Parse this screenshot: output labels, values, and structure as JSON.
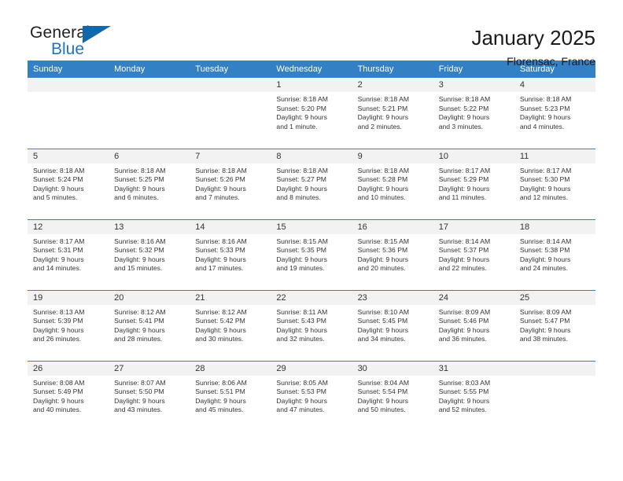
{
  "brand": {
    "name_top": "General",
    "name_bottom": "Blue",
    "accent_color": "#1268ad",
    "text_color": "#231f20"
  },
  "header": {
    "title": "January 2025",
    "location": "Florensac, France"
  },
  "calendar": {
    "header_bg": "#3480c4",
    "daynum_bg": "#f2f2f2",
    "weekdays": [
      "Sunday",
      "Monday",
      "Tuesday",
      "Wednesday",
      "Thursday",
      "Friday",
      "Saturday"
    ],
    "weeks": [
      [
        {
          "day": "",
          "sunrise": "",
          "sunset": "",
          "daylight_1": "",
          "daylight_2": ""
        },
        {
          "day": "",
          "sunrise": "",
          "sunset": "",
          "daylight_1": "",
          "daylight_2": ""
        },
        {
          "day": "",
          "sunrise": "",
          "sunset": "",
          "daylight_1": "",
          "daylight_2": ""
        },
        {
          "day": "1",
          "sunrise": "Sunrise: 8:18 AM",
          "sunset": "Sunset: 5:20 PM",
          "daylight_1": "Daylight: 9 hours",
          "daylight_2": "and 1 minute."
        },
        {
          "day": "2",
          "sunrise": "Sunrise: 8:18 AM",
          "sunset": "Sunset: 5:21 PM",
          "daylight_1": "Daylight: 9 hours",
          "daylight_2": "and 2 minutes."
        },
        {
          "day": "3",
          "sunrise": "Sunrise: 8:18 AM",
          "sunset": "Sunset: 5:22 PM",
          "daylight_1": "Daylight: 9 hours",
          "daylight_2": "and 3 minutes."
        },
        {
          "day": "4",
          "sunrise": "Sunrise: 8:18 AM",
          "sunset": "Sunset: 5:23 PM",
          "daylight_1": "Daylight: 9 hours",
          "daylight_2": "and 4 minutes."
        }
      ],
      [
        {
          "day": "5",
          "sunrise": "Sunrise: 8:18 AM",
          "sunset": "Sunset: 5:24 PM",
          "daylight_1": "Daylight: 9 hours",
          "daylight_2": "and 5 minutes."
        },
        {
          "day": "6",
          "sunrise": "Sunrise: 8:18 AM",
          "sunset": "Sunset: 5:25 PM",
          "daylight_1": "Daylight: 9 hours",
          "daylight_2": "and 6 minutes."
        },
        {
          "day": "7",
          "sunrise": "Sunrise: 8:18 AM",
          "sunset": "Sunset: 5:26 PM",
          "daylight_1": "Daylight: 9 hours",
          "daylight_2": "and 7 minutes."
        },
        {
          "day": "8",
          "sunrise": "Sunrise: 8:18 AM",
          "sunset": "Sunset: 5:27 PM",
          "daylight_1": "Daylight: 9 hours",
          "daylight_2": "and 8 minutes."
        },
        {
          "day": "9",
          "sunrise": "Sunrise: 8:18 AM",
          "sunset": "Sunset: 5:28 PM",
          "daylight_1": "Daylight: 9 hours",
          "daylight_2": "and 10 minutes."
        },
        {
          "day": "10",
          "sunrise": "Sunrise: 8:17 AM",
          "sunset": "Sunset: 5:29 PM",
          "daylight_1": "Daylight: 9 hours",
          "daylight_2": "and 11 minutes."
        },
        {
          "day": "11",
          "sunrise": "Sunrise: 8:17 AM",
          "sunset": "Sunset: 5:30 PM",
          "daylight_1": "Daylight: 9 hours",
          "daylight_2": "and 12 minutes."
        }
      ],
      [
        {
          "day": "12",
          "sunrise": "Sunrise: 8:17 AM",
          "sunset": "Sunset: 5:31 PM",
          "daylight_1": "Daylight: 9 hours",
          "daylight_2": "and 14 minutes."
        },
        {
          "day": "13",
          "sunrise": "Sunrise: 8:16 AM",
          "sunset": "Sunset: 5:32 PM",
          "daylight_1": "Daylight: 9 hours",
          "daylight_2": "and 15 minutes."
        },
        {
          "day": "14",
          "sunrise": "Sunrise: 8:16 AM",
          "sunset": "Sunset: 5:33 PM",
          "daylight_1": "Daylight: 9 hours",
          "daylight_2": "and 17 minutes."
        },
        {
          "day": "15",
          "sunrise": "Sunrise: 8:15 AM",
          "sunset": "Sunset: 5:35 PM",
          "daylight_1": "Daylight: 9 hours",
          "daylight_2": "and 19 minutes."
        },
        {
          "day": "16",
          "sunrise": "Sunrise: 8:15 AM",
          "sunset": "Sunset: 5:36 PM",
          "daylight_1": "Daylight: 9 hours",
          "daylight_2": "and 20 minutes."
        },
        {
          "day": "17",
          "sunrise": "Sunrise: 8:14 AM",
          "sunset": "Sunset: 5:37 PM",
          "daylight_1": "Daylight: 9 hours",
          "daylight_2": "and 22 minutes."
        },
        {
          "day": "18",
          "sunrise": "Sunrise: 8:14 AM",
          "sunset": "Sunset: 5:38 PM",
          "daylight_1": "Daylight: 9 hours",
          "daylight_2": "and 24 minutes."
        }
      ],
      [
        {
          "day": "19",
          "sunrise": "Sunrise: 8:13 AM",
          "sunset": "Sunset: 5:39 PM",
          "daylight_1": "Daylight: 9 hours",
          "daylight_2": "and 26 minutes."
        },
        {
          "day": "20",
          "sunrise": "Sunrise: 8:12 AM",
          "sunset": "Sunset: 5:41 PM",
          "daylight_1": "Daylight: 9 hours",
          "daylight_2": "and 28 minutes."
        },
        {
          "day": "21",
          "sunrise": "Sunrise: 8:12 AM",
          "sunset": "Sunset: 5:42 PM",
          "daylight_1": "Daylight: 9 hours",
          "daylight_2": "and 30 minutes."
        },
        {
          "day": "22",
          "sunrise": "Sunrise: 8:11 AM",
          "sunset": "Sunset: 5:43 PM",
          "daylight_1": "Daylight: 9 hours",
          "daylight_2": "and 32 minutes."
        },
        {
          "day": "23",
          "sunrise": "Sunrise: 8:10 AM",
          "sunset": "Sunset: 5:45 PM",
          "daylight_1": "Daylight: 9 hours",
          "daylight_2": "and 34 minutes."
        },
        {
          "day": "24",
          "sunrise": "Sunrise: 8:09 AM",
          "sunset": "Sunset: 5:46 PM",
          "daylight_1": "Daylight: 9 hours",
          "daylight_2": "and 36 minutes."
        },
        {
          "day": "25",
          "sunrise": "Sunrise: 8:09 AM",
          "sunset": "Sunset: 5:47 PM",
          "daylight_1": "Daylight: 9 hours",
          "daylight_2": "and 38 minutes."
        }
      ],
      [
        {
          "day": "26",
          "sunrise": "Sunrise: 8:08 AM",
          "sunset": "Sunset: 5:49 PM",
          "daylight_1": "Daylight: 9 hours",
          "daylight_2": "and 40 minutes."
        },
        {
          "day": "27",
          "sunrise": "Sunrise: 8:07 AM",
          "sunset": "Sunset: 5:50 PM",
          "daylight_1": "Daylight: 9 hours",
          "daylight_2": "and 43 minutes."
        },
        {
          "day": "28",
          "sunrise": "Sunrise: 8:06 AM",
          "sunset": "Sunset: 5:51 PM",
          "daylight_1": "Daylight: 9 hours",
          "daylight_2": "and 45 minutes."
        },
        {
          "day": "29",
          "sunrise": "Sunrise: 8:05 AM",
          "sunset": "Sunset: 5:53 PM",
          "daylight_1": "Daylight: 9 hours",
          "daylight_2": "and 47 minutes."
        },
        {
          "day": "30",
          "sunrise": "Sunrise: 8:04 AM",
          "sunset": "Sunset: 5:54 PM",
          "daylight_1": "Daylight: 9 hours",
          "daylight_2": "and 50 minutes."
        },
        {
          "day": "31",
          "sunrise": "Sunrise: 8:03 AM",
          "sunset": "Sunset: 5:55 PM",
          "daylight_1": "Daylight: 9 hours",
          "daylight_2": "and 52 minutes."
        },
        {
          "day": "",
          "sunrise": "",
          "sunset": "",
          "daylight_1": "",
          "daylight_2": ""
        }
      ]
    ]
  }
}
